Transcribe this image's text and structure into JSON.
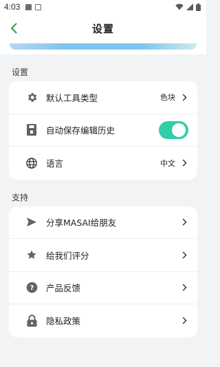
{
  "status_bar": {
    "time": "4:03"
  },
  "header": {
    "title": "设置"
  },
  "sections": {
    "settings": {
      "label": "设置",
      "items": [
        {
          "label": "默认工具类型",
          "value": "色块",
          "icon": "gear-icon"
        },
        {
          "label": "自动保存编辑历史",
          "toggle_on": true,
          "icon": "save-icon"
        },
        {
          "label": "语言",
          "value": "中文",
          "icon": "globe-icon"
        }
      ]
    },
    "support": {
      "label": "支持",
      "items": [
        {
          "label": "分享MASAI给朋友",
          "icon": "send-icon"
        },
        {
          "label": "给我们评分",
          "icon": "star-icon"
        },
        {
          "label": "产品反馈",
          "icon": "question-icon"
        },
        {
          "label": "隐私政策",
          "icon": "lock-icon"
        }
      ]
    }
  },
  "colors": {
    "accent": "#2ecfa8",
    "back_arrow": "#2e9b4e",
    "background": "#f2f3f5"
  }
}
